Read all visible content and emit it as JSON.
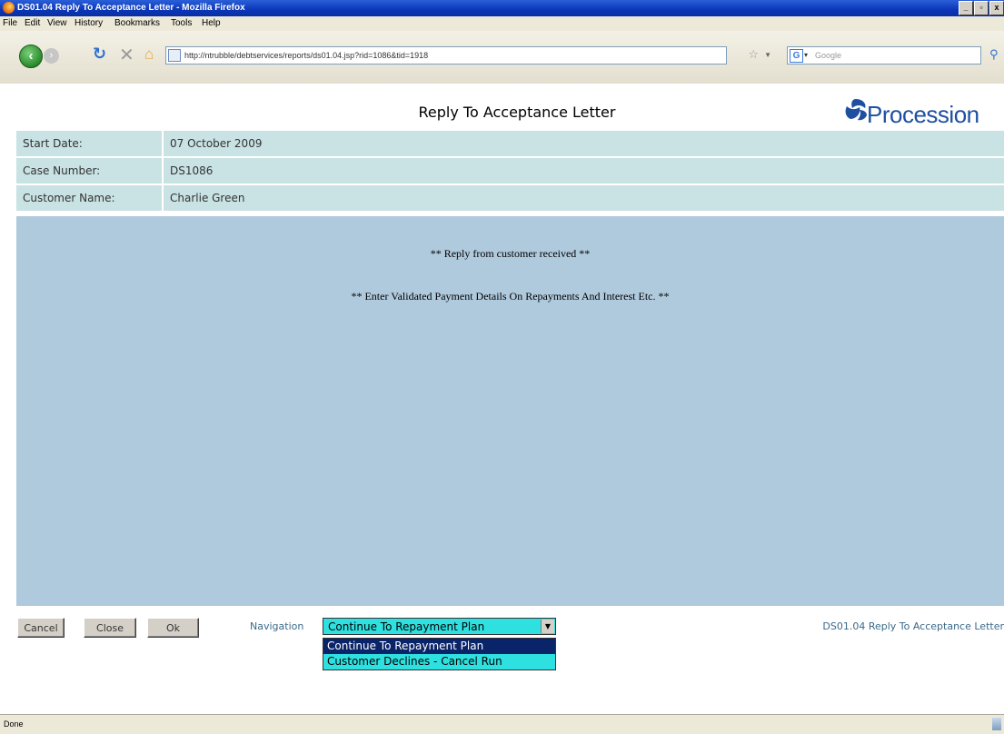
{
  "window": {
    "title": "DS01.04 Reply To Acceptance Letter - Mozilla Firefox",
    "buttons": {
      "minimize": "_",
      "maximize": "▫",
      "close": "x"
    }
  },
  "menu": [
    "File",
    "Edit",
    "View",
    "History",
    "Bookmarks",
    "Tools",
    "Help"
  ],
  "toolbar": {
    "url": "http://ntrubble/debtservices/reports/ds01.04.jsp?rid=1086&tid=1918",
    "search_placeholder": "Google",
    "search_engine_letter": "G"
  },
  "page": {
    "title": "Reply To Acceptance Letter",
    "logo_text": "Procession",
    "fields": [
      {
        "label": "Start Date:",
        "value": "07 October 2009"
      },
      {
        "label": "Case Number:",
        "value": "DS1086"
      },
      {
        "label": "Customer Name:",
        "value": "Charlie Green"
      }
    ],
    "messages": [
      "** Reply from customer received **",
      "** Enter Validated Payment Details On Repayments And Interest Etc. **"
    ],
    "buttons": {
      "cancel": "Cancel",
      "close": "Close",
      "ok": "Ok"
    },
    "navigation": {
      "label": "Navigation",
      "selected": "Continue To Repayment Plan",
      "options": [
        "Continue To Repayment Plan",
        "Customer Declines - Cancel Run"
      ]
    },
    "page_id": "DS01.04 Reply To Acceptance Letter"
  },
  "status": {
    "text": "Done"
  },
  "colors": {
    "field_row": "#c9e2e4",
    "message_panel": "#b0cadd",
    "select_bg": "#2fe0e0",
    "select_highlight": "#0a246a",
    "logo": "#1f4fa0"
  }
}
